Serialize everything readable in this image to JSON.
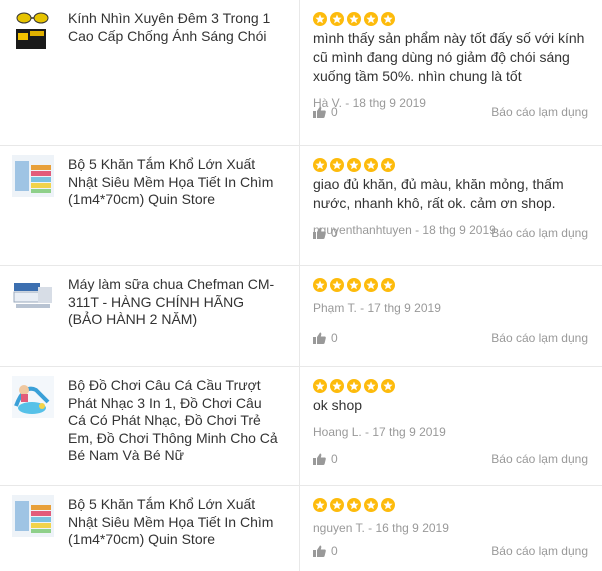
{
  "reviews": [
    {
      "product_name": "Kính Nhìn Xuyên Đêm 3 Trong 1 Cao Cấp Chống Ánh Sáng Chói",
      "thumbnail": "night-glasses-thumbnail",
      "stars": 5,
      "text": "mình thấy sản phẩm này tốt đấy số với kính cũ mình đang dùng nó giảm độ chói sáng xuống tầm 50%. nhìn chung là tốt",
      "author_date": "Hà V. - 18 thg 9 2019",
      "likes": "0",
      "report_label": "Báo cáo lạm dụng"
    },
    {
      "product_name": "Bộ 5 Khăn Tắm Khổ Lớn Xuất Nhật Siêu Mềm Họa Tiết In Chìm (1m4*70cm) Quin Store",
      "thumbnail": "towel-set-thumbnail",
      "stars": 5,
      "text": "giao đủ khăn, đủ màu, khăn mỏng, thấm nước, nhanh khô, rất ok. cảm ơn shop.",
      "author_date": "nguyenthanhtuyen - 18 thg 9 2019",
      "likes": "0",
      "report_label": "Báo cáo lạm dụng"
    },
    {
      "product_name": "Máy làm sữa chua Chefman CM-311T - HÀNG CHÍNH HÃNG (BẢO HÀNH 2 NĂM)",
      "thumbnail": "yogurt-maker-thumbnail",
      "stars": 5,
      "text": "",
      "author_date": "Phạm T. - 17 thg 9 2019",
      "likes": "0",
      "report_label": "Báo cáo lạm dụng"
    },
    {
      "product_name": "Bộ Đồ Chơi Câu Cá Cầu Trượt Phát Nhạc 3 In 1, Đồ Chơi Câu Cá Có Phát Nhạc, Đồ Chơi Trẻ Em, Đồ Chơi Thông Minh Cho Cả Bé Nam Và Bé Nữ",
      "thumbnail": "fishing-toy-thumbnail",
      "stars": 5,
      "text": "ok shop",
      "author_date": "Hoang L. - 17 thg 9 2019",
      "likes": "0",
      "report_label": "Báo cáo lạm dụng"
    },
    {
      "product_name": "Bộ 5 Khăn Tắm Khổ Lớn Xuất Nhật Siêu Mềm Họa Tiết In Chìm (1m4*70cm) Quin Store",
      "thumbnail": "towel-set-thumbnail",
      "stars": 5,
      "text": "",
      "author_date": "nguyen T. - 16 thg 9 2019",
      "likes": "0",
      "report_label": "Báo cáo lạm dụng"
    }
  ],
  "colors": {
    "star": "#fdbb0c",
    "muted": "#999999",
    "text": "#333333",
    "divider": "#e8e8e8"
  }
}
